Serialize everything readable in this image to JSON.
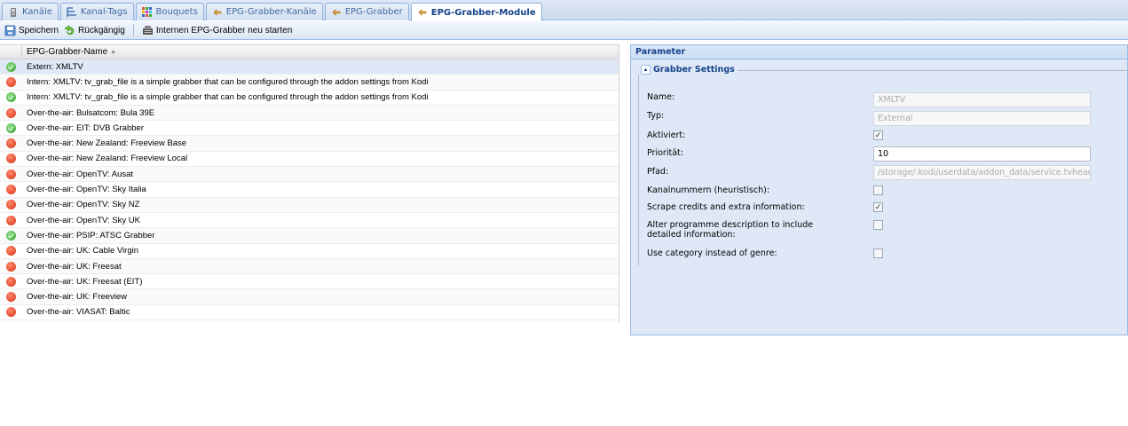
{
  "tabs": [
    {
      "label": "Kanäle",
      "icon": "channels-icon",
      "active": false
    },
    {
      "label": "Kanal-Tags",
      "icon": "channel-tags-icon",
      "active": false
    },
    {
      "label": "Bouquets",
      "icon": "bouquets-icon",
      "active": false
    },
    {
      "label": "EPG-Grabber-Kanäle",
      "icon": "epg-grabber-channels-icon",
      "active": false
    },
    {
      "label": "EPG-Grabber",
      "icon": "epg-grabber-icon",
      "active": false
    },
    {
      "label": "EPG-Grabber-Module",
      "icon": "epg-grabber-modules-icon",
      "active": true
    }
  ],
  "toolbar": {
    "save_label": "Speichern",
    "undo_label": "Rückgängig",
    "restart_label": "Internen EPG-Grabber neu starten"
  },
  "grid": {
    "column_header": "EPG-Grabber-Name",
    "rows": [
      {
        "name": "Extern: XMLTV",
        "status": "ok"
      },
      {
        "name": "Intern: XMLTV: tv_grab_file is a simple grabber that can be configured through the addon settings from Kodi",
        "status": "err"
      },
      {
        "name": "Intern: XMLTV: tv_grab_file is a simple grabber that can be configured through the addon settings from Kodi",
        "status": "ok"
      },
      {
        "name": "Over-the-air: Bulsatcom: Bula 39E",
        "status": "err"
      },
      {
        "name": "Over-the-air: EIT: DVB Grabber",
        "status": "ok"
      },
      {
        "name": "Over-the-air: New Zealand: Freeview Base",
        "status": "err"
      },
      {
        "name": "Over-the-air: New Zealand: Freeview Local",
        "status": "err"
      },
      {
        "name": "Over-the-air: OpenTV: Ausat",
        "status": "err"
      },
      {
        "name": "Over-the-air: OpenTV: Sky Italia",
        "status": "err"
      },
      {
        "name": "Over-the-air: OpenTV: Sky NZ",
        "status": "err"
      },
      {
        "name": "Over-the-air: OpenTV: Sky UK",
        "status": "err"
      },
      {
        "name": "Over-the-air: PSIP: ATSC Grabber",
        "status": "ok"
      },
      {
        "name": "Over-the-air: UK: Cable Virgin",
        "status": "err"
      },
      {
        "name": "Over-the-air: UK: Freesat",
        "status": "err"
      },
      {
        "name": "Over-the-air: UK: Freesat (EIT)",
        "status": "err"
      },
      {
        "name": "Over-the-air: UK: Freeview",
        "status": "err"
      },
      {
        "name": "Over-the-air: VIASAT: Baltic",
        "status": "err"
      }
    ]
  },
  "panel": {
    "title": "Parameter",
    "fieldset_title": "Grabber Settings",
    "fields": {
      "name": {
        "label": "Name:",
        "value": "XMLTV"
      },
      "type": {
        "label": "Typ:",
        "value": "External"
      },
      "enabled": {
        "label": "Aktiviert:",
        "checked": true
      },
      "priority": {
        "label": "Priorität:",
        "value": "10"
      },
      "path": {
        "label": "Pfad:",
        "value": "/storage/.kodi/userdata/addon_data/service.tvheadend"
      },
      "channel_numbers": {
        "label": "Kanalnummern (heuristisch):",
        "checked": false
      },
      "scrape_credits": {
        "label": "Scrape credits and extra information:",
        "checked": true
      },
      "alter_description": {
        "label": "Alter programme description to include detailed information:",
        "checked": false
      },
      "use_category": {
        "label": "Use category instead of genre:",
        "checked": false
      }
    }
  },
  "colors": {
    "status_ok": "#2f9e2a",
    "status_err": "#d4300f",
    "accent": "#15428b",
    "panel_bg": "#dfe8f6"
  }
}
